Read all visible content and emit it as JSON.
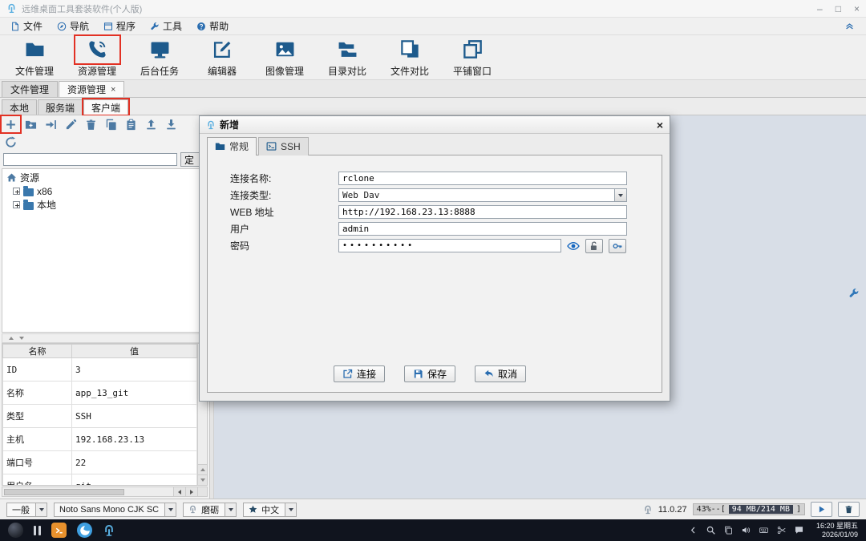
{
  "titlebar": {
    "title": "远维桌面工具套装软件(个人版)",
    "minimize": "–",
    "maximize": "□",
    "close": "×"
  },
  "menubar": {
    "items": [
      {
        "label": "文件"
      },
      {
        "label": "导航"
      },
      {
        "label": "程序"
      },
      {
        "label": "工具"
      },
      {
        "label": "帮助"
      }
    ]
  },
  "toolbar": {
    "items": [
      {
        "label": "文件管理"
      },
      {
        "label": "资源管理"
      },
      {
        "label": "后台任务"
      },
      {
        "label": "编辑器"
      },
      {
        "label": "图像管理"
      },
      {
        "label": "目录对比"
      },
      {
        "label": "文件对比"
      },
      {
        "label": "平铺窗口"
      }
    ]
  },
  "doc_tabs": [
    {
      "label": "文件管理"
    },
    {
      "label": "资源管理",
      "close": "×"
    }
  ],
  "sub_tabs": [
    {
      "label": "本地"
    },
    {
      "label": "服务端"
    },
    {
      "label": "客户端"
    }
  ],
  "left_panel": {
    "locate_button": "定",
    "tree": {
      "root": "资源",
      "nodes": [
        {
          "label": "x86"
        },
        {
          "label": "本地"
        }
      ]
    },
    "properties": {
      "headers": [
        "名称",
        "值"
      ],
      "rows": [
        {
          "name": "ID",
          "value": "3"
        },
        {
          "name": "名称",
          "value": "app_13_git"
        },
        {
          "name": "类型",
          "value": "SSH"
        },
        {
          "name": "主机",
          "value": "192.168.23.13"
        },
        {
          "name": "端口号",
          "value": "22"
        },
        {
          "name": "用户名",
          "value": "git"
        }
      ]
    }
  },
  "dialog": {
    "title": "新增",
    "close": "×",
    "tabs": [
      {
        "label": "常规"
      },
      {
        "label": "SSH"
      }
    ],
    "fields": {
      "name": {
        "label": "连接名称:",
        "value": "rclone"
      },
      "type": {
        "label": "连接类型:",
        "value": "Web Dav"
      },
      "url": {
        "label": "WEB 地址",
        "value": "http://192.168.23.13:8888"
      },
      "user": {
        "label": "用户",
        "value": "admin"
      },
      "password": {
        "label": "密码",
        "value": "••••••••••"
      }
    },
    "buttons": {
      "connect": "连接",
      "save": "保存",
      "cancel": "取消"
    }
  },
  "statusbar": {
    "level": "一般",
    "font": "Noto Sans Mono CJK SC",
    "theme": "磨砺",
    "language": "中文",
    "version": "11.0.27",
    "memory_prefix": "43%--[",
    "memory_value": "94 MB/214 MB",
    "memory_suffix": "]"
  },
  "taskbar": {
    "clock_time": "16:20 星期五",
    "clock_date": "2026/01/09"
  },
  "colors": {
    "accent": "#1d5a8c",
    "highlight_red": "#e23124",
    "taskbar_bg": "#10141e",
    "content_bg": "#d8dee7"
  }
}
